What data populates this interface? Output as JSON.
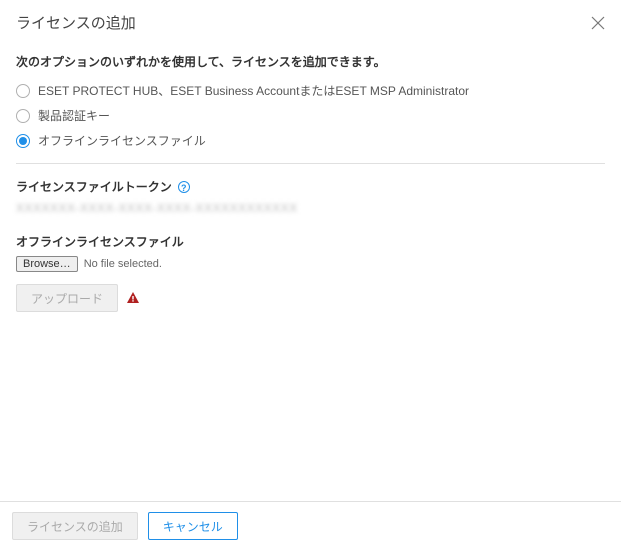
{
  "header": {
    "title": "ライセンスの追加"
  },
  "instruction": "次のオプションのいずれかを使用して、ライセンスを追加できます。",
  "options": [
    {
      "label": "ESET PROTECT HUB、ESET Business AccountまたはESET MSP Administrator",
      "selected": false
    },
    {
      "label": "製品認証キー",
      "selected": false
    },
    {
      "label": "オフラインライセンスファイル",
      "selected": true
    }
  ],
  "token_section": {
    "label": "ライセンスファイルトークン",
    "value": "XXXXXXX-XXXX-XXXX-XXXX-XXXXXXXXXXXX"
  },
  "file_section": {
    "label": "オフラインライセンスファイル",
    "browse_label": "Browse…",
    "no_file_text": "No file selected."
  },
  "upload": {
    "label": "アップロード"
  },
  "footer": {
    "add_label": "ライセンスの追加",
    "cancel_label": "キャンセル"
  }
}
